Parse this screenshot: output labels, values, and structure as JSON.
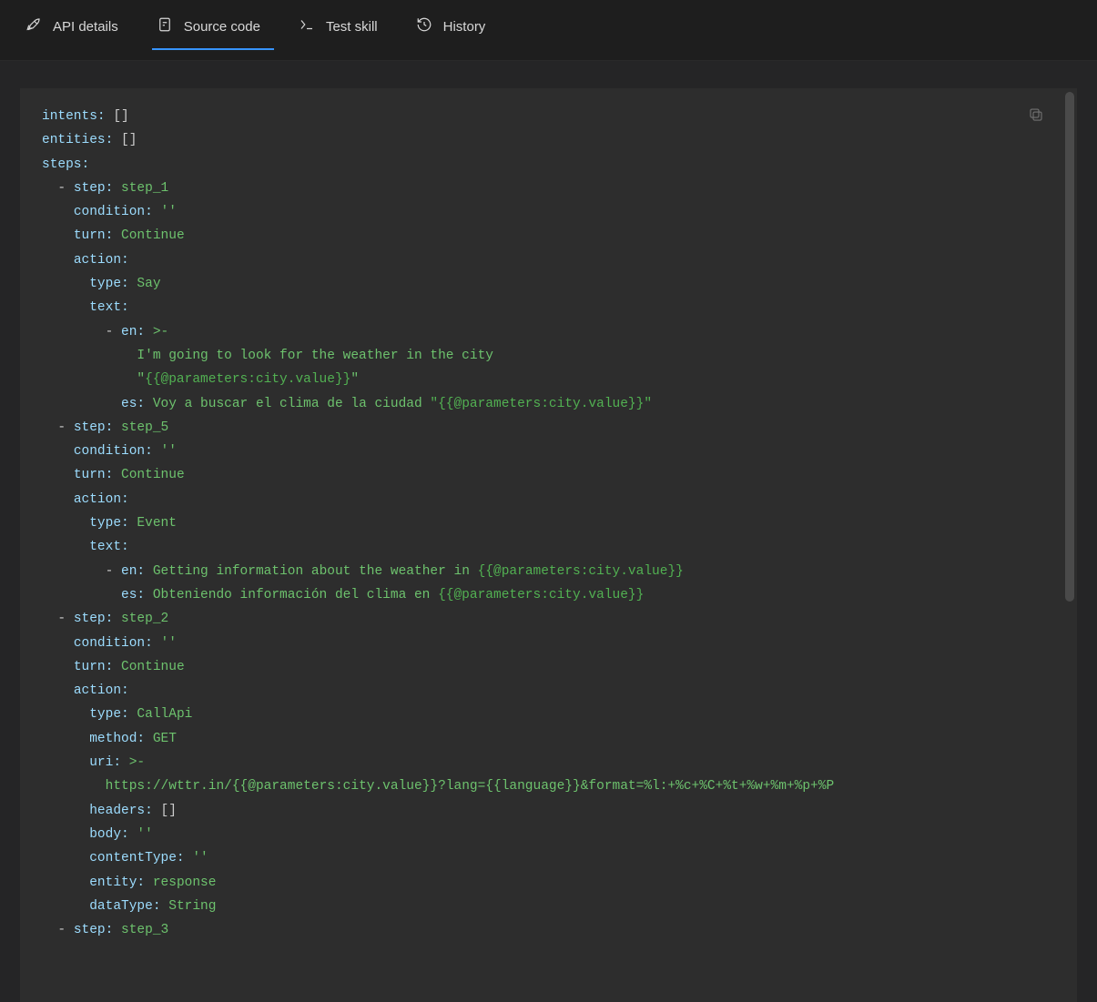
{
  "tabs": {
    "api": "API details",
    "source": "Source code",
    "test": "Test skill",
    "history": "History",
    "active": "source"
  },
  "code": {
    "intents_key": "intents:",
    "intents_val": " []",
    "entities_key": "entities:",
    "entities_val": " []",
    "steps_key": "steps:",
    "dash": "- ",
    "step_key": "step:",
    "step1_val": " step_1",
    "condition_key": "condition:",
    "condition_val": " ''",
    "turn_key": "turn:",
    "turn_val": " Continue",
    "action_key": "action:",
    "type_key": "type:",
    "type_say": " Say",
    "text_key": "text:",
    "en_key": "en:",
    "en_multiline": " >-",
    "en_line1": "I'm going to look for the weather in the city",
    "en_line2a": "\"",
    "en_line2b": "{{@parameters:city.value}}",
    "en_line2c": "\"",
    "es_key": "es:",
    "es_val1a": " Voy a buscar el clima de la ciudad ",
    "es_val1b": "\"{{@parameters:city.value}}\"",
    "step5_val": " step_5",
    "type_event": " Event",
    "en5a": " Getting information about the weather in ",
    "en5b": "{{@parameters:city.value}}",
    "es5a": " Obteniendo información del clima en ",
    "es5b": "{{@parameters:city.value}}",
    "step2_val": " step_2",
    "type_callapi": " CallApi",
    "method_key": "method:",
    "method_val": " GET",
    "uri_key": "uri:",
    "uri_multiline": " >-",
    "uri_val": "https://wttr.in/{{@parameters:city.value}}?lang={{language}}&format=%l:+%c+%C+%t+%w+%m+%p+%P",
    "headers_key": "headers:",
    "headers_val": " []",
    "body_key": "body:",
    "body_val": " ''",
    "contenttype_key": "contentType:",
    "contenttype_val": " ''",
    "entity_key": "entity:",
    "entity_val": " response",
    "datatype_key": "dataType:",
    "datatype_val": " String",
    "step3_val": " step_3"
  }
}
